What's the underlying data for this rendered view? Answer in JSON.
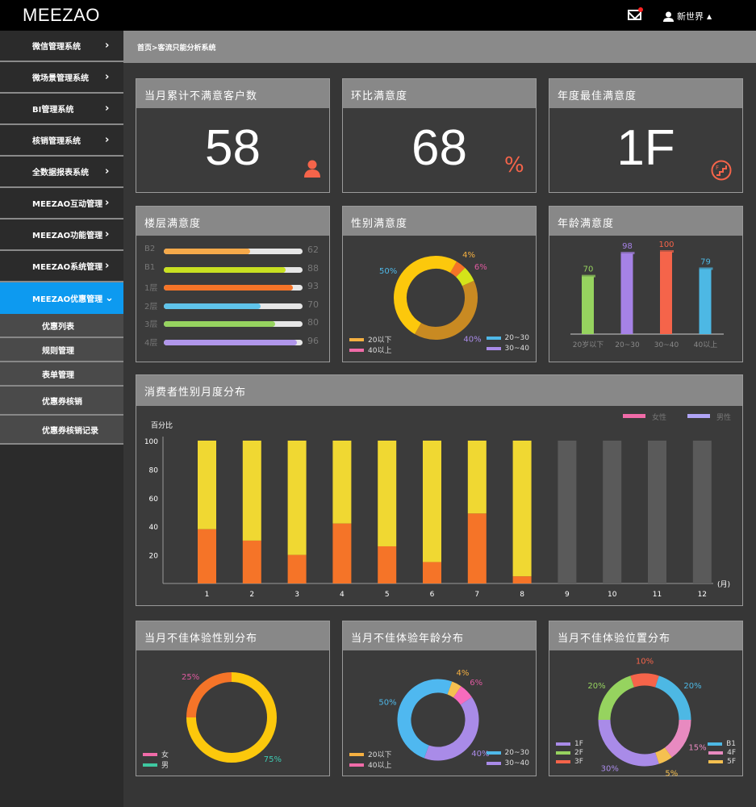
{
  "header": {
    "logo": "MEEZAO",
    "user": "新世界",
    "icons": [
      "mail-icon",
      "user-icon",
      "caret-up-icon"
    ],
    "notification_color": "#ff2222"
  },
  "sidebar": {
    "items": [
      {
        "label": "微信管理系统"
      },
      {
        "label": "微场景管理系统"
      },
      {
        "label": "BI管理系统"
      },
      {
        "label": "核销管理系统"
      },
      {
        "label": "全数据报表系统"
      },
      {
        "label": "MEEZAO互动管理"
      },
      {
        "label": "MEEZAO功能管理"
      },
      {
        "label": "MEEZAO系统管理"
      },
      {
        "label": "MEEZAO优惠管理",
        "active": true
      }
    ],
    "subitems": [
      {
        "label": "优惠列表"
      },
      {
        "label": "规则管理"
      },
      {
        "label": "表单管理"
      },
      {
        "label": "优惠券核销"
      },
      {
        "label": "优惠券核销记录"
      }
    ],
    "accent": "#0d9af0"
  },
  "breadcrumb": "首页>客流只能分析系统",
  "kpis": [
    {
      "title": "当月累计不满意客户数",
      "value": "58",
      "icon": "user-icon"
    },
    {
      "title": "环比满意度",
      "value": "68",
      "icon": "percent-icon",
      "icon_text": "%"
    },
    {
      "title": "年度最佳满意度",
      "value": "1F",
      "icon": "stairs-icon"
    }
  ],
  "chart_data": [
    {
      "title": "楼层满意度",
      "type": "bar",
      "orientation": "horizontal",
      "categories": [
        "B2",
        "B1",
        "1层",
        "2层",
        "3层",
        "4层"
      ],
      "values": [
        62,
        88,
        93,
        70,
        80,
        96
      ],
      "colors": [
        "#f5a94a",
        "#c8e021",
        "#f57428",
        "#5fc3ea",
        "#96d35f",
        "#b096ea"
      ],
      "xlim": [
        0,
        100
      ]
    },
    {
      "title": "性别满意度",
      "type": "pie",
      "donut": true,
      "segments": [
        {
          "label": "4%",
          "value": 4,
          "color": "#f57428",
          "label_color": "#f5b041"
        },
        {
          "label": "6%",
          "value": 6,
          "color": "#d4e419",
          "label_color": "#e05aa0"
        },
        {
          "label": "40%",
          "value": 40,
          "color": "#c98a22",
          "label_color": "#a98be8"
        },
        {
          "label": "50%",
          "value": 50,
          "color": "#fcc80c",
          "label_color": "#4fb8e8"
        }
      ],
      "legend": [
        {
          "name": "20以下",
          "color": "#f5b041"
        },
        {
          "name": "40以上",
          "color": "#f06ba8"
        },
        {
          "name": "20~30",
          "color": "#4fb8e8"
        },
        {
          "name": "30~40",
          "color": "#a98be8"
        }
      ]
    },
    {
      "title": "年龄满意度",
      "type": "bar",
      "categories": [
        "20岁以下",
        "20~30",
        "30~40",
        "40以上"
      ],
      "values": [
        70,
        98,
        100,
        79
      ],
      "colors": [
        "#96d35f",
        "#a682e6",
        "#f5644a",
        "#4db8e4"
      ],
      "ylim": [
        0,
        100
      ]
    },
    {
      "title": "消费者性别月度分布",
      "type": "bar",
      "stacked": true,
      "ylabel": "百分比",
      "xlabel": "(月)",
      "categories": [
        "1",
        "2",
        "3",
        "4",
        "5",
        "6",
        "7",
        "8",
        "9",
        "10",
        "11",
        "12"
      ],
      "yticks": [
        20,
        40,
        60,
        80,
        100
      ],
      "ylim": [
        0,
        100
      ],
      "series": [
        {
          "name": "女性",
          "values": [
            38,
            30,
            20,
            42,
            26,
            15,
            49,
            5,
            null,
            null,
            null,
            null
          ],
          "color": "#f57428",
          "legend_color": "#f06ba8"
        },
        {
          "name": "男性",
          "values": [
            62,
            70,
            80,
            58,
            74,
            85,
            51,
            95,
            null,
            null,
            null,
            null
          ],
          "color": "#f0d832",
          "legend_color": "#b0a4f5"
        }
      ],
      "empty_color": "#5a5a5a",
      "legend": "top-right"
    },
    {
      "title": "当月不佳体验性别分布",
      "type": "pie",
      "donut": true,
      "segments": [
        {
          "label": "75%",
          "value": 75,
          "color": "#fcc80c",
          "label_color": "#3ec8b0"
        },
        {
          "label": "25%",
          "value": 25,
          "color": "#f57428",
          "label_color": "#e05aa0"
        }
      ],
      "legend": [
        {
          "name": "女",
          "color": "#f06ba8"
        },
        {
          "name": "男",
          "color": "#3ec8a0"
        }
      ]
    },
    {
      "title": "当月不佳体验年龄分布",
      "type": "pie",
      "donut": true,
      "segments": [
        {
          "label": "4%",
          "value": 4,
          "color": "#f5c050",
          "label_color": "#f5b041"
        },
        {
          "label": "6%",
          "value": 6,
          "color": "#f76bbd",
          "label_color": "#e05aa0"
        },
        {
          "label": "40%",
          "value": 40,
          "color": "#a98be8",
          "label_color": "#a98be8"
        },
        {
          "label": "50%",
          "value": 50,
          "color": "#4fb8f0",
          "label_color": "#4fb8e8"
        }
      ],
      "legend": [
        {
          "name": "20以下",
          "color": "#f5b041"
        },
        {
          "name": "40以上",
          "color": "#f06ba8"
        },
        {
          "name": "20~30",
          "color": "#4fb8e8"
        },
        {
          "name": "30~40",
          "color": "#a98be8"
        }
      ]
    },
    {
      "title": "当月不佳体验位置分布",
      "type": "pie",
      "donut": true,
      "segments": [
        {
          "label": "10%",
          "value": 10,
          "color": "#f5644a",
          "label_color": "#f5644a"
        },
        {
          "label": "20%",
          "value": 20,
          "color": "#4db8e4",
          "label_color": "#4db8e4"
        },
        {
          "label": "15%",
          "value": 15,
          "color": "#e88ac0",
          "label_color": "#e88ac0"
        },
        {
          "label": "5%",
          "value": 5,
          "color": "#f5c050",
          "label_color": "#f5c050"
        },
        {
          "label": "30%",
          "value": 30,
          "color": "#a98be8",
          "label_color": "#a98be8"
        },
        {
          "label": "20%",
          "value": 20,
          "color": "#96d35f",
          "label_color": "#96d35f"
        }
      ],
      "legend": [
        {
          "name": "1F",
          "color": "#a98be8"
        },
        {
          "name": "2F",
          "color": "#96d35f"
        },
        {
          "name": "3F",
          "color": "#f5644a"
        },
        {
          "name": "B1",
          "color": "#4db8e4"
        },
        {
          "name": "4F",
          "color": "#e88ac0"
        },
        {
          "name": "5F",
          "color": "#f5c050"
        }
      ]
    }
  ]
}
